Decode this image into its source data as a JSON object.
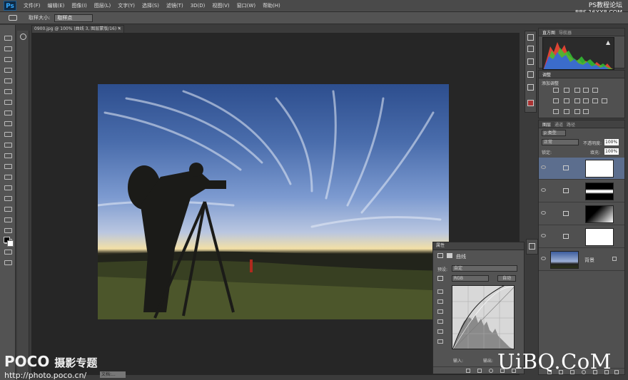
{
  "app": {
    "logo": "Ps"
  },
  "menu": [
    "文件(F)",
    "编辑(E)",
    "图像(I)",
    "图层(L)",
    "文字(Y)",
    "选择(S)",
    "滤镜(T)",
    "3D(D)",
    "视图(V)",
    "窗口(W)",
    "帮助(H)"
  ],
  "watermark_top": {
    "line1": "PS教程论坛",
    "line2": "BBS.16XX8.COM"
  },
  "options": {
    "label": "取样大小:",
    "value": "取样点"
  },
  "document": {
    "tab": "0900.jpg @ 100% (曲线 3, 图层蒙版/16) *",
    "close": "×"
  },
  "panels": {
    "histogram_tabs": [
      "直方图",
      "导航器"
    ],
    "adjust_tabs": [
      "调整"
    ],
    "adjust_label": "添加调整",
    "layers_tabs": [
      "图层",
      "通道",
      "路径"
    ],
    "layers_kind": "p 类型",
    "blend_mode": "正常",
    "opacity_label": "不透明度:",
    "opacity_value": "100%",
    "lock_label": "锁定:",
    "fill_label": "填充:",
    "fill_value": "100%",
    "background_layer": "背景"
  },
  "properties": {
    "title": "属性",
    "adj_name": "曲线",
    "preset_label": "预设:",
    "preset_value": "自定",
    "channel": "RGB",
    "auto_button": "自动",
    "input_label": "输入:",
    "output_label": "输出:"
  },
  "status": {
    "text": "文档:..."
  },
  "watermarks": {
    "poco_brand": "POCO",
    "poco_title": "摄影专题",
    "poco_url": "http://photo.poco.cn/",
    "uibq": "UiBQ.CoM"
  },
  "colors": {
    "accent": "#31a8ff",
    "active_layer": "#5c6e8e"
  }
}
